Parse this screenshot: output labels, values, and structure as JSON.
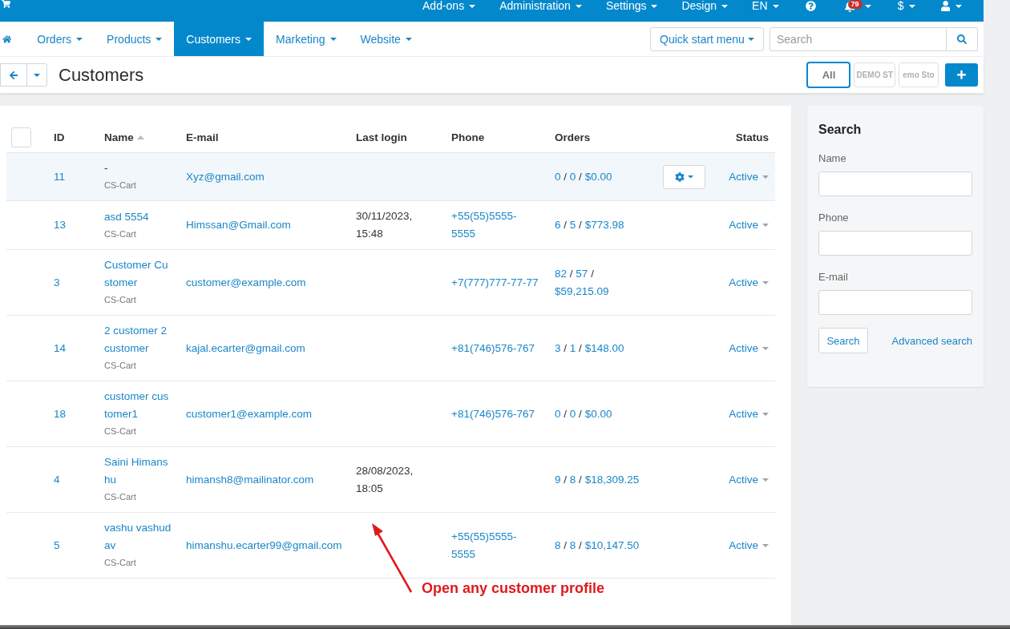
{
  "top_bar": {
    "items": [
      {
        "kind": "menu",
        "label": "Add-ons"
      },
      {
        "kind": "menu",
        "label": "Administration"
      },
      {
        "kind": "menu",
        "label": "Settings"
      },
      {
        "kind": "menu",
        "label": "Design"
      },
      {
        "kind": "menu",
        "label": "EN"
      },
      {
        "kind": "help"
      },
      {
        "kind": "notifications",
        "badge": "79"
      },
      {
        "kind": "menu",
        "label": "$"
      },
      {
        "kind": "user"
      }
    ]
  },
  "nav": {
    "tabs": [
      {
        "label": "Orders",
        "selected": false
      },
      {
        "label": "Products",
        "selected": false
      },
      {
        "label": "Customers",
        "selected": true
      },
      {
        "label": "Marketing",
        "selected": false
      },
      {
        "label": "Website",
        "selected": false
      }
    ],
    "quick_start": "Quick start menu",
    "search": {
      "placeholder": "Search"
    }
  },
  "toolbar": {
    "title": "Customers",
    "stores": [
      {
        "kind": "text",
        "label": "All",
        "selected": true
      },
      {
        "kind": "logo",
        "label": "DEMO ST",
        "selected": false
      },
      {
        "kind": "logo",
        "label": "emo Sto",
        "selected": false
      }
    ]
  },
  "table": {
    "select_all": {
      "checked": false
    },
    "columns": [
      {
        "label": "ID",
        "sorted": false
      },
      {
        "label": "Name",
        "sorted": true
      },
      {
        "label": "E-mail",
        "sorted": false
      },
      {
        "label": "Last login",
        "sorted": false
      },
      {
        "label": "Phone",
        "sorted": false
      },
      {
        "label": "Orders",
        "sorted": false
      },
      {
        "label": "Status",
        "sorted": false
      }
    ],
    "orders_separator": "/",
    "rows": [
      {
        "id": "11",
        "name": "-",
        "name_link": false,
        "storefront": "CS-Cart",
        "email": "Xyz@gmail.com",
        "orders": [
          "0",
          "0",
          "$0.00"
        ],
        "status": "Active",
        "hovered": true
      },
      {
        "id": "13",
        "name": "asd 5554",
        "name_link": true,
        "storefront": "CS-Cart",
        "email": "Himssan@Gmail.com",
        "last_login": "30/11/2023, 15:48",
        "phone": "+55(55)5555-5555",
        "orders": [
          "6",
          "5",
          "$773.98"
        ],
        "status": "Active",
        "hovered": false
      },
      {
        "id": "3",
        "name": "Customer Customer",
        "name_link": true,
        "storefront": "CS-Cart",
        "email": "customer@example.com",
        "phone": "+7(777)777-77-77",
        "orders": [
          "82",
          "57",
          "$59,215.09"
        ],
        "status": "Active",
        "hovered": false
      },
      {
        "id": "14",
        "name": "2 customer 2 customer",
        "name_link": true,
        "storefront": "CS-Cart",
        "email": "kajal.ecarter@gmail.com",
        "phone": "+81(746)576-767",
        "orders": [
          "3",
          "1",
          "$148.00"
        ],
        "status": "Active",
        "hovered": false
      },
      {
        "id": "18",
        "name": "customer customer1",
        "name_link": true,
        "storefront": "CS-Cart",
        "email": "customer1@example.com",
        "phone": "+81(746)576-767",
        "orders": [
          "0",
          "0",
          "$0.00"
        ],
        "status": "Active",
        "hovered": false
      },
      {
        "id": "4",
        "name": "Saini Himanshu",
        "name_link": true,
        "storefront": "CS-Cart",
        "email": "himansh8@mailinator.com",
        "last_login": "28/08/2023, 18:05",
        "orders": [
          "9",
          "8",
          "$18,309.25"
        ],
        "status": "Active",
        "hovered": false
      },
      {
        "id": "5",
        "name": "vashu vashudav",
        "name_link": true,
        "storefront": "CS-Cart",
        "email": "himanshu.ecarter99@gmail.com",
        "phone": "+55(55)5555-5555",
        "orders": [
          "8",
          "8",
          "$10,147.50"
        ],
        "status": "Active",
        "hovered": false
      }
    ]
  },
  "sidebar": {
    "title": "Search",
    "fields": [
      {
        "label": "Name"
      },
      {
        "label": "Phone"
      },
      {
        "label": "E-mail"
      }
    ],
    "button": "Search",
    "link": "Advanced search"
  },
  "annotation": {
    "text": "Open any customer profile"
  }
}
